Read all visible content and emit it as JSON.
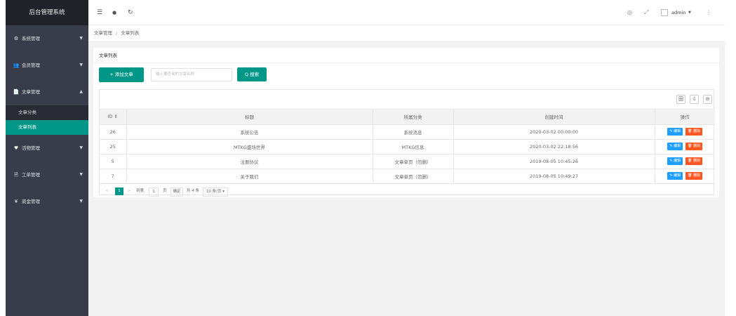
{
  "sidebar": {
    "logo": "后台管理系统",
    "menus": [
      {
        "label": "系统管理",
        "icon": "⚙",
        "caret": "▼"
      },
      {
        "label": "会员管理",
        "icon": "👥",
        "caret": "▼"
      },
      {
        "label": "文章管理",
        "icon": "📄",
        "caret": "▲"
      },
      {
        "label": "活物管理",
        "icon": "♥",
        "caret": "▼"
      },
      {
        "label": "工单管理",
        "icon": "🗎",
        "caret": "▼"
      },
      {
        "label": "资金管理",
        "icon": "¥",
        "caret": "▼"
      }
    ],
    "submenu": [
      {
        "label": "文章分类"
      },
      {
        "label": "文章列表"
      }
    ]
  },
  "header": {
    "menu_icon": "☰",
    "chat_icon": "●",
    "refresh_icon": "↻",
    "theme_icon": "◎",
    "fullscreen_icon": "⤢",
    "user_name": "admin",
    "user_caret": "▼",
    "more_icon": "⋮"
  },
  "breadcrumb": {
    "items": [
      "文章管理",
      "文章列表"
    ],
    "separator": "/"
  },
  "card": {
    "title": "文章列表",
    "add_button": "+ 添加文章",
    "search_placeholder": "输入要查询的文章名称",
    "search_button": "Q 搜索"
  },
  "table": {
    "toolbar_icons": [
      "田",
      "⇩",
      "⊖"
    ],
    "headers": [
      "ID ⇕",
      "标题",
      "所属分类",
      "创建时间",
      "操作"
    ],
    "rows": [
      {
        "id": "26",
        "title": "系统公告",
        "category": "系统消息",
        "time": "2020-03-02 00:00:00"
      },
      {
        "id": "25",
        "title": "MTKG盛场世界",
        "category": "MTKG信息",
        "time": "2020-03-02 22:18:56"
      },
      {
        "id": "5",
        "title": "注册协议",
        "category": "文章单页（勿删）",
        "time": "2019-08-05 10:45:26"
      },
      {
        "id": "7",
        "title": "关于我们",
        "category": "文章单页（勿删）",
        "time": "2019-08-05 10:49:27"
      }
    ],
    "edit_label": "✎ 编辑",
    "delete_label": "🗑 删除"
  },
  "pager": {
    "prev": "<",
    "current": "1",
    "next": ">",
    "goto_label": "到第",
    "page_value": "1",
    "page_unit": "页",
    "confirm": "确定",
    "total": "共 4 条",
    "page_size": "10 条/页 ▾"
  },
  "colors": {
    "accent": "#009688",
    "sidebar_bg": "#393d49",
    "edit": "#1e9fff",
    "delete": "#ff5722"
  }
}
